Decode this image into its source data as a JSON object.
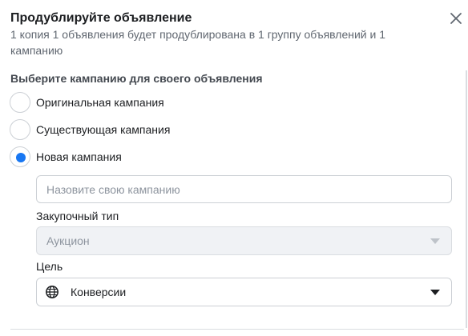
{
  "dialog": {
    "title": "Продублируйте объявление",
    "subtitle": "1 копия 1 объявления будет продублирована в 1 группу объявлений и 1 кампанию",
    "close_icon": "close-icon"
  },
  "campaign_choice": {
    "label": "Выберите кампанию для своего объявления",
    "options": [
      {
        "label": "Оригинальная кампания",
        "selected": false
      },
      {
        "label": "Существующая кампания",
        "selected": false
      },
      {
        "label": "Новая кампания",
        "selected": true
      }
    ]
  },
  "new_campaign": {
    "name_placeholder": "Назовите свою кампанию",
    "name_value": "",
    "buying_type_label": "Закупочный тип",
    "buying_type_value": "Аукцион",
    "objective_label": "Цель",
    "objective_value": "Конверсии",
    "objective_icon": "globe-icon"
  },
  "colors": {
    "accent": "#1877f2",
    "text": "#1c1e21",
    "muted": "#606770",
    "border": "#ccd0d5",
    "disabled_bg": "#f0f2f5"
  }
}
